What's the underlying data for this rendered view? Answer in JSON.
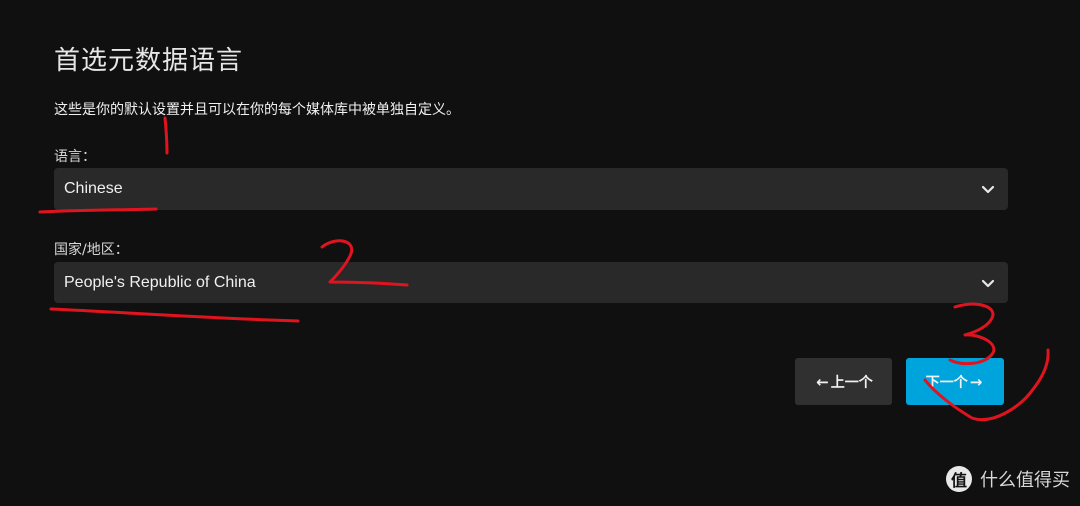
{
  "page": {
    "title": "首选元数据语言",
    "description": "这些是你的默认设置并且可以在你的每个媒体库中被单独自定义。"
  },
  "language": {
    "label": "语言：",
    "selected": "Chinese"
  },
  "country": {
    "label": "国家/地区：",
    "selected": "People's Republic of China"
  },
  "buttons": {
    "prev_label": "上一个",
    "prev_icon": "←",
    "next_label": "下一个",
    "next_icon": "→"
  },
  "annotations": {
    "mark1": "1",
    "mark2": "2",
    "mark3": "3"
  },
  "watermark": {
    "logo": "值",
    "text": "什么值得买"
  },
  "colors": {
    "background": "#101010",
    "field": "#292929",
    "button_secondary": "#303030",
    "accent": "#00a4dc",
    "annotation": "#e0141e"
  }
}
